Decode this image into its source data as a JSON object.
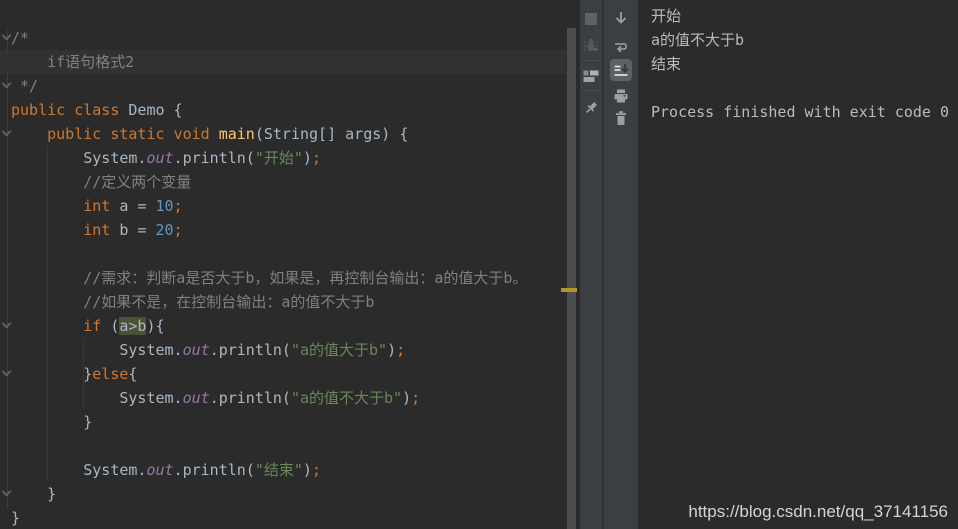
{
  "app": {
    "name": "IDE run view - Java if statement demo"
  },
  "theme": {
    "editor_bg": "#2B2B2B",
    "panel_bg": "#3C3F41",
    "caret_line_bg": "#323232",
    "identifier_highlight_bg": "#4C5133",
    "keyword": "#CC7832",
    "string": "#6A8759",
    "number": "#6897BB",
    "comment": "#808080",
    "field": "#9876AA",
    "method": "#FFC66D",
    "default_text": "#A9B7C6",
    "console_text": "#BBBBBB",
    "scrollbar_mark": "#B3962B",
    "icon_gray": "#9DA0A2"
  },
  "editor": {
    "lines": [
      {
        "seg": [
          [
            "/*",
            "cmt"
          ]
        ]
      },
      {
        "hl": true,
        "seg": [
          [
            "    if语句格式2",
            "cmt"
          ]
        ]
      },
      {
        "seg": [
          [
            " */",
            "cmt"
          ]
        ]
      },
      {
        "seg": [
          [
            "public",
            "kw"
          ],
          [
            " ",
            "plain"
          ],
          [
            "class",
            "kw"
          ],
          [
            " Demo {",
            "plain"
          ]
        ]
      },
      {
        "seg": [
          [
            "    ",
            "plain"
          ],
          [
            "public",
            "kw"
          ],
          [
            " ",
            "plain"
          ],
          [
            "static",
            "kw"
          ],
          [
            " ",
            "plain"
          ],
          [
            "void",
            "kw"
          ],
          [
            " ",
            "plain"
          ],
          [
            "main",
            "meth"
          ],
          [
            "(String[] args) {",
            "plain"
          ]
        ]
      },
      {
        "seg": [
          [
            "        System.",
            "plain"
          ],
          [
            "out",
            "field"
          ],
          [
            ".println(",
            "plain"
          ],
          [
            "\"开始\"",
            "str"
          ],
          [
            ")",
            "plain"
          ],
          [
            ";",
            "semi"
          ]
        ]
      },
      {
        "seg": [
          [
            "        ",
            "plain"
          ],
          [
            "//定义两个变量",
            "cmt"
          ]
        ]
      },
      {
        "seg": [
          [
            "        ",
            "plain"
          ],
          [
            "int",
            "kw"
          ],
          [
            " a = ",
            "plain"
          ],
          [
            "10",
            "num"
          ],
          [
            ";",
            "semi"
          ]
        ]
      },
      {
        "seg": [
          [
            "        ",
            "plain"
          ],
          [
            "int",
            "kw"
          ],
          [
            " b = ",
            "plain"
          ],
          [
            "20",
            "num"
          ],
          [
            ";",
            "semi"
          ]
        ]
      },
      {
        "seg": []
      },
      {
        "seg": [
          [
            "        ",
            "plain"
          ],
          [
            "//需求：判断a是否大于b，如果是，再控制台输出：a的值大于b。",
            "cmt"
          ]
        ]
      },
      {
        "seg": [
          [
            "        ",
            "plain"
          ],
          [
            "//如果不是，在控制台输出：a的值不大于b",
            "cmt"
          ]
        ]
      },
      {
        "seg": [
          [
            "        ",
            "plain"
          ],
          [
            "if",
            "kw"
          ],
          [
            " (",
            "plain"
          ],
          [
            "a>b",
            "plain",
            "sel"
          ],
          [
            "){",
            "plain"
          ]
        ]
      },
      {
        "seg": [
          [
            "            System.",
            "plain"
          ],
          [
            "out",
            "field"
          ],
          [
            ".println(",
            "plain"
          ],
          [
            "\"a的值大于b\"",
            "str"
          ],
          [
            ")",
            "plain"
          ],
          [
            ";",
            "semi"
          ]
        ]
      },
      {
        "seg": [
          [
            "        }",
            "plain"
          ],
          [
            "else",
            "kw"
          ],
          [
            "{",
            "plain"
          ]
        ]
      },
      {
        "seg": [
          [
            "            System.",
            "plain"
          ],
          [
            "out",
            "field"
          ],
          [
            ".println(",
            "plain"
          ],
          [
            "\"a的值不大于b\"",
            "str"
          ],
          [
            ")",
            "plain"
          ],
          [
            ";",
            "semi"
          ]
        ]
      },
      {
        "seg": [
          [
            "        }",
            "plain"
          ]
        ]
      },
      {
        "seg": []
      },
      {
        "seg": [
          [
            "        System.",
            "plain"
          ],
          [
            "out",
            "field"
          ],
          [
            ".println(",
            "plain"
          ],
          [
            "\"结束\"",
            "str"
          ],
          [
            ")",
            "plain"
          ],
          [
            ";",
            "semi"
          ]
        ]
      },
      {
        "seg": [
          [
            "    }",
            "plain"
          ]
        ]
      },
      {
        "seg": [
          [
            "}",
            "plain"
          ]
        ]
      }
    ]
  },
  "toolbars": {
    "run_strip_icons": [
      "stop",
      "rerun-debug",
      "restore-layout",
      "pin-tab"
    ],
    "console_strip_icons": [
      "down-stack-trace",
      "soft-wrap",
      "scroll-to-end (toggled on)",
      "print",
      "clear-all"
    ]
  },
  "console": {
    "lines": [
      "开始",
      "a的值不大于b",
      "结束",
      "",
      "Process finished with exit code 0"
    ]
  },
  "watermark": {
    "text": "https://blog.csdn.net/qq_37141156"
  }
}
